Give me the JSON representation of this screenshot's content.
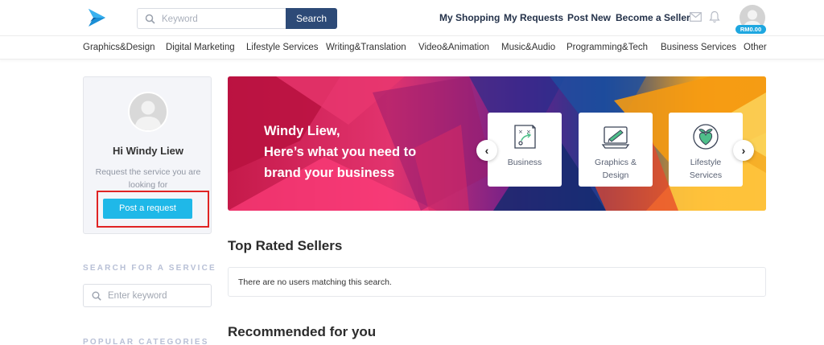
{
  "header": {
    "search_placeholder": "Keyword",
    "search_button": "Search",
    "nav": [
      "My Shopping",
      "My Requests",
      "Post New",
      "Become a Seller"
    ],
    "balance": "RM0.00"
  },
  "categories": [
    "Graphics&Design",
    "Digital Marketing",
    "Lifestyle Services",
    "Writing&Translation",
    "Video&Animation",
    "Music&Audio",
    "Programming&Tech",
    "Business Services",
    "Other"
  ],
  "sidebar": {
    "greeting": "Hi Windy Liew",
    "prompt": "Request the service you are looking for",
    "post_button": "Post a request",
    "search_heading": "SEARCH FOR A SERVICE",
    "search_placeholder": "Enter keyword",
    "categories_heading": "POPULAR CATEGORIES"
  },
  "banner": {
    "line1": "Windy Liew,",
    "line2": "Here’s what you need to",
    "line3": "brand your business",
    "cards": [
      {
        "line1": "Business",
        "line2": ""
      },
      {
        "line1": "Graphics &",
        "line2": "Design"
      },
      {
        "line1": "Lifestyle",
        "line2": "Services"
      }
    ],
    "prev_arrow": "‹",
    "next_arrow": "›"
  },
  "main": {
    "top_rated_title": "Top Rated Sellers",
    "no_users_text": "There are no users matching this search.",
    "recommended_title": "Recommended for you"
  },
  "colors": {
    "search_button": "#2d4a77",
    "post_button": "#1fb8e8",
    "highlight": "#e02424",
    "balance_badge": "#1ea7e0"
  }
}
